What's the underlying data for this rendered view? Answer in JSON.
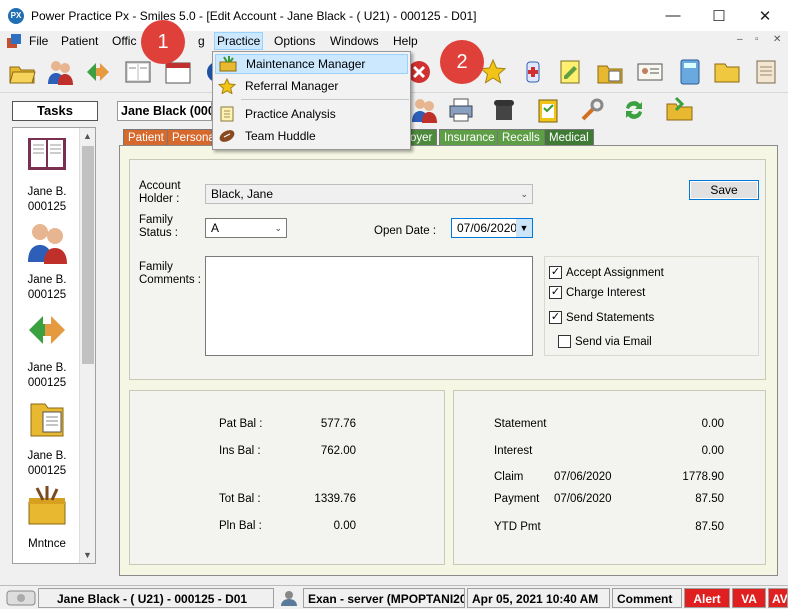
{
  "window": {
    "title": "Power Practice Px - Smiles 5.0 - [Edit Account - Jane Black - ( U21) - 000125 - D01]",
    "icon_text": "PX",
    "controls": [
      "—",
      "☐",
      "✕"
    ]
  },
  "menubar": {
    "items": [
      {
        "label": "File"
      },
      {
        "label": "Patient"
      },
      {
        "label": "Offic"
      },
      {
        "label": "g"
      },
      {
        "label": "Practice"
      },
      {
        "label": "Options"
      },
      {
        "label": "Windows"
      },
      {
        "label": "Help"
      }
    ],
    "mdi_controls": [
      "–",
      "▫",
      "✕"
    ]
  },
  "practice_menu": {
    "items": [
      {
        "label": "Maintenance Manager",
        "icon": "maintenance-icon"
      },
      {
        "label": "Referral Manager",
        "icon": "star-icon"
      },
      {
        "label": "Practice Analysis",
        "icon": "notepad-icon"
      },
      {
        "label": "Team Huddle",
        "icon": "football-icon"
      }
    ]
  },
  "callouts": [
    "1",
    "2"
  ],
  "tasks": {
    "title": "Tasks",
    "items": [
      {
        "line1": "Jane B.",
        "line2": "000125",
        "icon": "book-icon"
      },
      {
        "line1": "Jane B.",
        "line2": "000125",
        "icon": "people-icon"
      },
      {
        "line1": "Jane B.",
        "line2": "000125",
        "icon": "transfer-icon"
      },
      {
        "line1": "Jane B.",
        "line2": "000125",
        "icon": "document-icon"
      },
      {
        "line1": "Mntnce",
        "line2": "",
        "icon": "toolbox-icon"
      }
    ]
  },
  "patient_header": "Jane Black (000",
  "tabs": [
    {
      "label": "Patient",
      "color": "#d8692d"
    },
    {
      "label": "Persona",
      "color": "#d8692d"
    },
    {
      "label": "oyer",
      "color": "#4d8a3c"
    },
    {
      "label": "Insurance",
      "color": "#5d9e46"
    },
    {
      "label": "Recalls",
      "color": "#5d9e46"
    },
    {
      "label": "Medical",
      "color": "#3f7b34"
    }
  ],
  "form": {
    "account_holder_label_1": "Account",
    "account_holder_label_2": "Holder :",
    "account_holder_value": "Black, Jane",
    "family_status_label_1": "Family",
    "family_status_label_2": "Status :",
    "family_status_value": "A",
    "open_date_label": "Open  Date :",
    "open_date_value": "07/06/2020",
    "family_comments_label_1": "Family",
    "family_comments_label_2": "Comments :",
    "family_comments_value": "",
    "save_label": "Save",
    "checkboxes": [
      {
        "label": "Accept Assignment",
        "checked": true
      },
      {
        "label": "Charge Interest",
        "checked": true
      },
      {
        "label": "Send Statements",
        "checked": true
      },
      {
        "label": "Send via Email",
        "checked": false
      }
    ]
  },
  "balances": {
    "pat_bal_label": "Pat Bal :",
    "pat_bal": "577.76",
    "ins_bal_label": "Ins Bal :",
    "ins_bal": "762.00",
    "tot_bal_label": "Tot Bal :",
    "tot_bal": "1339.76",
    "pln_bal_label": "Pln Bal :",
    "pln_bal": "0.00"
  },
  "account_summary": {
    "statement_label": "Statement",
    "statement": "0.00",
    "interest_label": "Interest",
    "interest": "0.00",
    "claim_label": "Claim",
    "claim_date": "07/06/2020",
    "claim": "1778.90",
    "payment_label": "Payment",
    "payment_date": "07/06/2020",
    "payment": "87.50",
    "ytd_label": "YTD Pmt",
    "ytd": "87.50"
  },
  "statusbar": {
    "patient": "Jane Black - ( U21) - 000125 - D01",
    "user": "Exan - server (MPOPTANI20",
    "datetime": "Apr 05, 2021 10:40 AM",
    "comment": "Comment",
    "alert": "Alert",
    "va": "VA",
    "av": "AV"
  },
  "colors": {
    "accent_red": "#e0403a",
    "menu_highlight": "#cce8ff",
    "panel_bg": "#f6f6e4"
  }
}
